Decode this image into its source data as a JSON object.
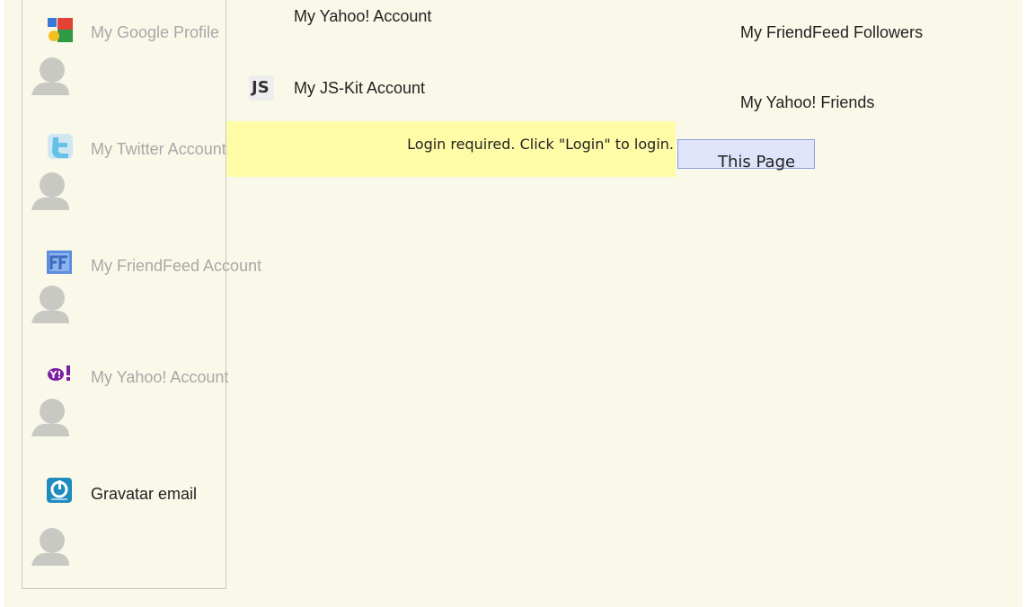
{
  "services": [
    {
      "label": "My Google Profile",
      "icon": "google-icon"
    },
    {
      "label": "My Twitter Account",
      "icon": "twitter-icon"
    },
    {
      "label": "My FriendFeed Account",
      "icon": "friendfeed-icon"
    },
    {
      "label": "My Yahoo! Account",
      "icon": "yahoo-icon"
    },
    {
      "label": "Gravatar email",
      "icon": "gravatar-icon"
    }
  ],
  "middle": {
    "yahoo_account": "My Yahoo! Account",
    "jskit_account": "My JS-Kit Account",
    "jskit_icon_text": "JS",
    "login_message": "Login required. Click \"Login\" to login.",
    "this_page": "This Page"
  },
  "right": {
    "friendfeed_followers": "My FriendFeed Followers",
    "yahoo_friends": "My Yahoo! Friends"
  },
  "icon_glyphs": {
    "yahoo": "Y!"
  },
  "colors": {
    "background": "#faf8e9",
    "login_highlight": "#fefca6",
    "tab_fill": "#dfe4fb",
    "tab_border": "#8e9fd7",
    "muted_text": "#a8a8a8"
  }
}
